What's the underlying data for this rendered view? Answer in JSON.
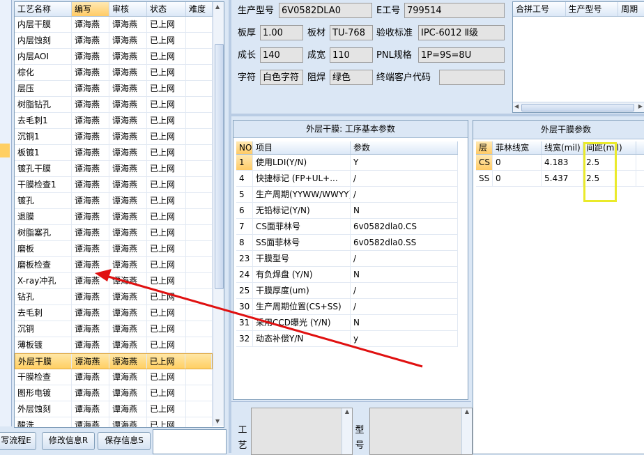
{
  "process_grid": {
    "columns": [
      "工艺名称",
      "编写",
      "审核",
      "状态",
      "难度"
    ],
    "rows": [
      [
        "内层干膜",
        "谭海燕",
        "谭海燕",
        "已上网",
        ""
      ],
      [
        "内层蚀刻",
        "谭海燕",
        "谭海燕",
        "已上网",
        ""
      ],
      [
        "内层AOI",
        "谭海燕",
        "谭海燕",
        "已上网",
        ""
      ],
      [
        "棕化",
        "谭海燕",
        "谭海燕",
        "已上网",
        ""
      ],
      [
        "层压",
        "谭海燕",
        "谭海燕",
        "已上网",
        ""
      ],
      [
        "树脂钻孔",
        "谭海燕",
        "谭海燕",
        "已上网",
        ""
      ],
      [
        "去毛刺1",
        "谭海燕",
        "谭海燕",
        "已上网",
        ""
      ],
      [
        "沉铜1",
        "谭海燕",
        "谭海燕",
        "已上网",
        ""
      ],
      [
        "板镀1",
        "谭海燕",
        "谭海燕",
        "已上网",
        ""
      ],
      [
        "镀孔干膜",
        "谭海燕",
        "谭海燕",
        "已上网",
        ""
      ],
      [
        "干膜检查1",
        "谭海燕",
        "谭海燕",
        "已上网",
        ""
      ],
      [
        "镀孔",
        "谭海燕",
        "谭海燕",
        "已上网",
        ""
      ],
      [
        "退膜",
        "谭海燕",
        "谭海燕",
        "已上网",
        ""
      ],
      [
        "树脂塞孔",
        "谭海燕",
        "谭海燕",
        "已上网",
        ""
      ],
      [
        "磨板",
        "谭海燕",
        "谭海燕",
        "已上网",
        ""
      ],
      [
        "磨板检查",
        "谭海燕",
        "谭海燕",
        "已上网",
        ""
      ],
      [
        "X-ray冲孔",
        "谭海燕",
        "谭海燕",
        "已上网",
        ""
      ],
      [
        "钻孔",
        "谭海燕",
        "谭海燕",
        "已上网",
        ""
      ],
      [
        "去毛刺",
        "谭海燕",
        "谭海燕",
        "已上网",
        ""
      ],
      [
        "沉铜",
        "谭海燕",
        "谭海燕",
        "已上网",
        ""
      ],
      [
        "薄板镀",
        "谭海燕",
        "谭海燕",
        "已上网",
        ""
      ],
      [
        "外层干膜",
        "谭海燕",
        "谭海燕",
        "已上网",
        ""
      ],
      [
        "干膜检查",
        "谭海燕",
        "谭海燕",
        "已上网",
        ""
      ],
      [
        "图形电镀",
        "谭海燕",
        "谭海燕",
        "已上网",
        ""
      ],
      [
        "外层蚀刻",
        "谭海燕",
        "谭海燕",
        "已上网",
        ""
      ],
      [
        "酸洗",
        "谭海燕",
        "谭海燕",
        "已上网",
        ""
      ]
    ],
    "selected_index": 21
  },
  "buttons": {
    "write_flow": "写流程E",
    "modify_info": "修改信息R",
    "save_info": "保存信息S"
  },
  "form": {
    "product_model_label": "生产型号",
    "product_model_value": "6V0582DLA0",
    "e_number_label": "E工号",
    "e_number_value": "799514",
    "thickness_label": "板厚",
    "thickness_value": "1.00",
    "material_label": "板材",
    "material_value": "TU-768",
    "acceptance_label": "验收标准",
    "acceptance_value": "IPC-6012 Ⅱ级",
    "length_label": "成长",
    "length_value": "140",
    "width_label": "成宽",
    "width_value": "110",
    "pnl_label": "PNL规格",
    "pnl_value": "1P=9S=8U",
    "char_label": "字符",
    "char_value": "白色字符",
    "mask_label": "阻焊",
    "mask_value": "绿色",
    "customer_label": "终端客户代码",
    "customer_value": ""
  },
  "combine_table": {
    "columns": [
      "合拼工号",
      "生产型号",
      "周期"
    ]
  },
  "param_panel": {
    "title": "外层干膜: 工序基本参数",
    "columns": [
      "NO",
      "项目",
      "参数"
    ],
    "rows": [
      [
        "1",
        "使用LDI(Y/N)",
        "Y"
      ],
      [
        "4",
        "快捷标记 (FP+UL+...",
        "/"
      ],
      [
        "5",
        "生产周期(YYWW/WWYY)",
        "/"
      ],
      [
        "6",
        "无铅标记(Y/N)",
        "N"
      ],
      [
        "7",
        "CS面菲林号",
        "6v0582dla0.CS"
      ],
      [
        "8",
        "SS面菲林号",
        "6v0582dla0.SS"
      ],
      [
        "23",
        "干膜型号",
        "/"
      ],
      [
        "24",
        "有负焊盘 (Y/N)",
        "N"
      ],
      [
        "25",
        "干膜厚度(um)",
        "/"
      ],
      [
        "30",
        "生产周期位置(CS+SS)",
        "/"
      ],
      [
        "31",
        "采用CCD曝光 (Y/N)",
        "N"
      ],
      [
        "32",
        "动态补偿Y/N",
        "y"
      ]
    ]
  },
  "film_panel": {
    "title": "外层干膜参数",
    "columns": [
      "层",
      "菲林线宽",
      "线宽(mil)",
      "间距(mil)"
    ],
    "rows": [
      [
        "CS",
        "0",
        "4.183",
        "2.5"
      ],
      [
        "SS",
        "0",
        "5.437",
        "2.5"
      ]
    ]
  },
  "bottom": {
    "process_label": "工艺",
    "model_label": "型号"
  },
  "colors": {
    "selection": "#ffcf63",
    "highlight_box": "#eaea2a",
    "arrow": "#e01010"
  }
}
